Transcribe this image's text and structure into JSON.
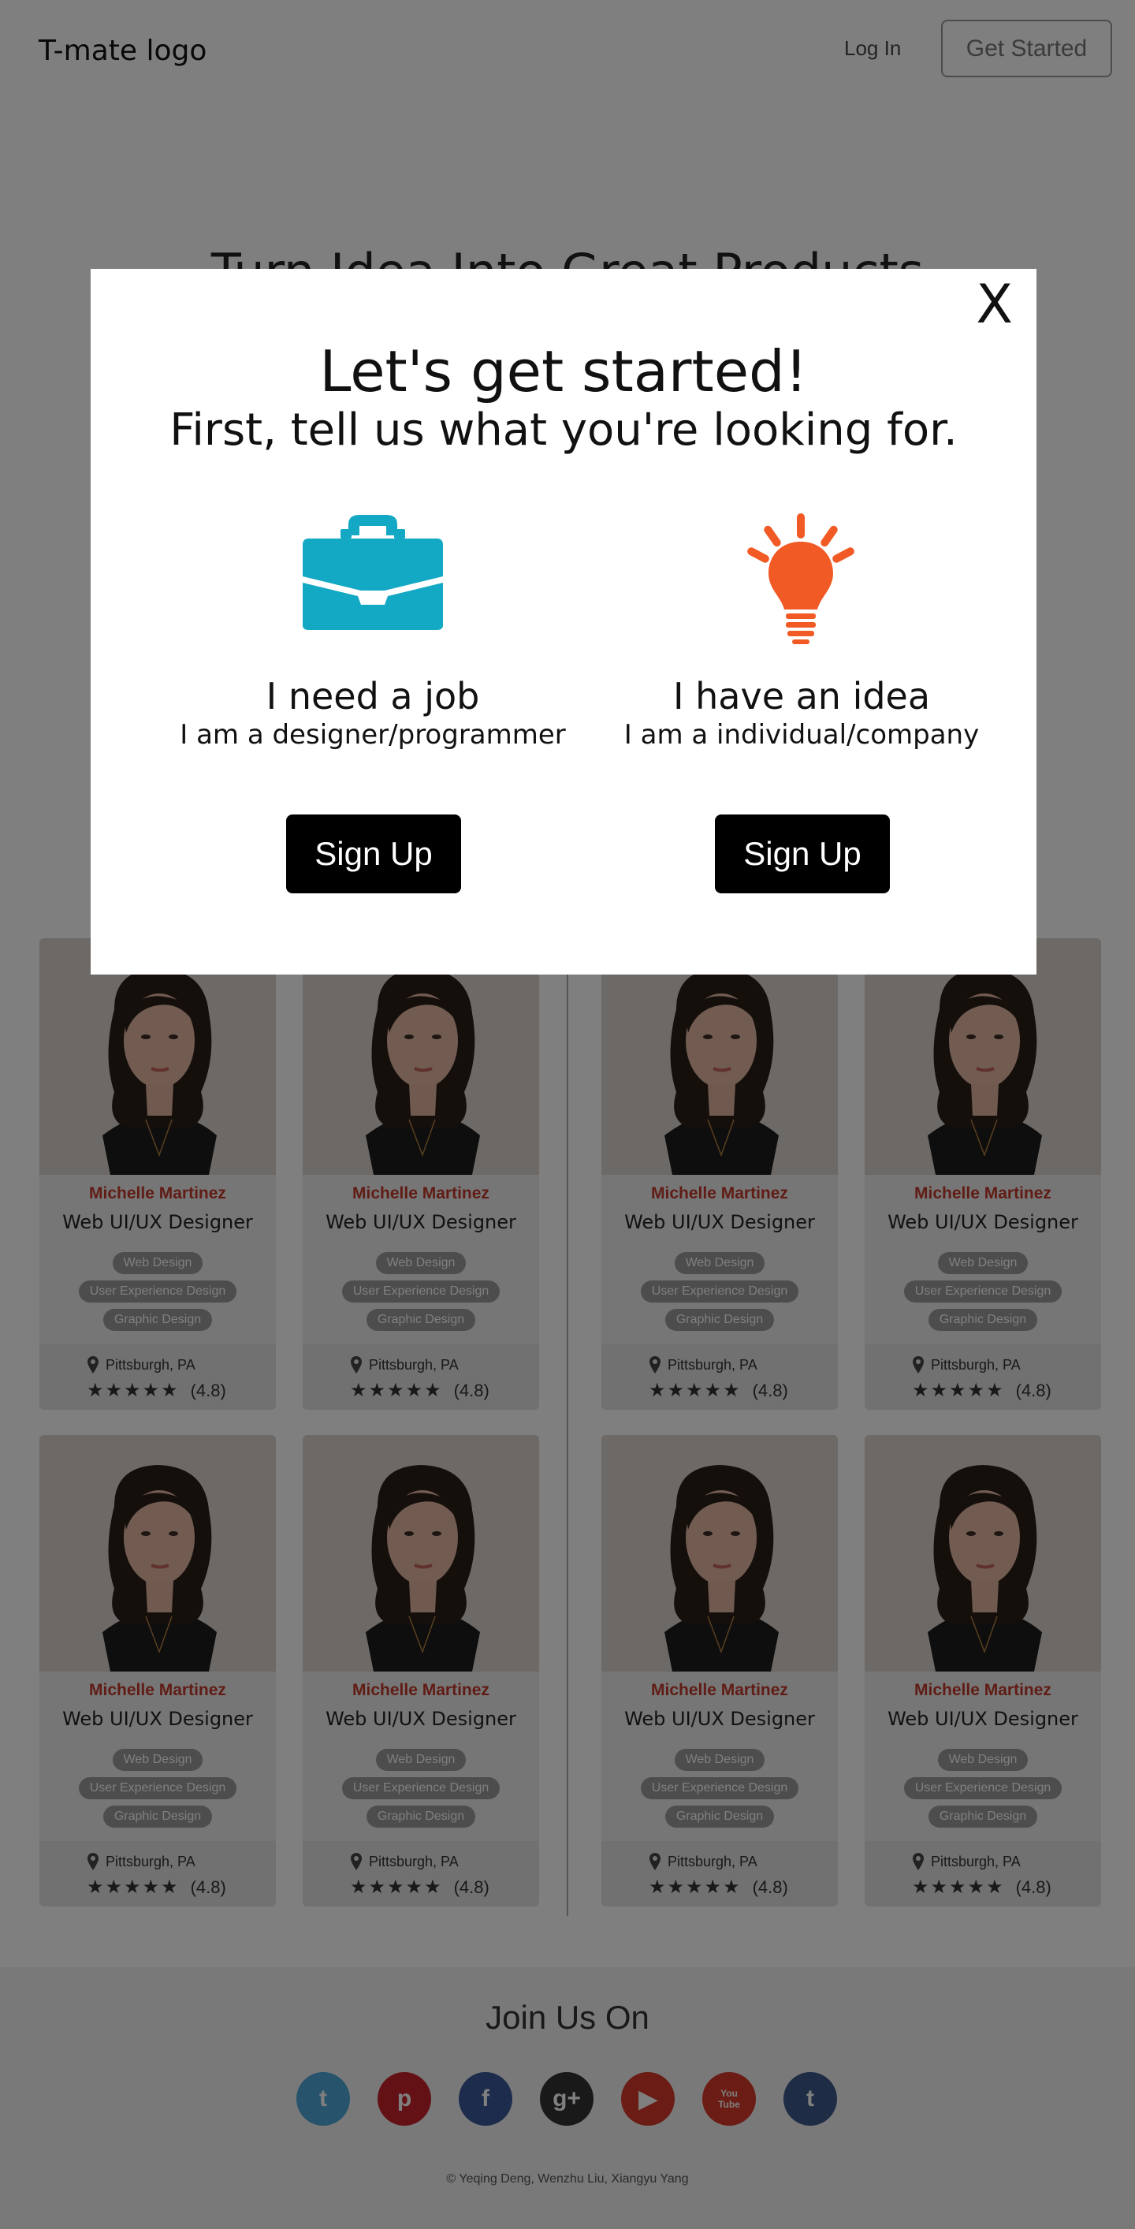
{
  "header": {
    "logo": "T-mate logo",
    "login": "Log In",
    "get_started": "Get Started"
  },
  "hero": {
    "title": "Turn Idea Into Great Products"
  },
  "cards": [
    {
      "name": "Michelle Martinez",
      "role": "Web UI/UX Designer",
      "tags": [
        "Web Design",
        "User Experience Design",
        "Graphic Design"
      ],
      "location": "Pittsburgh, PA",
      "rating": "(4.8)",
      "stars": "★★★★★"
    },
    {
      "name": "Michelle Martinez",
      "role": "Web UI/UX Designer",
      "tags": [
        "Web Design",
        "User Experience Design",
        "Graphic Design"
      ],
      "location": "Pittsburgh, PA",
      "rating": "(4.8)",
      "stars": "★★★★★"
    },
    {
      "name": "Michelle Martinez",
      "role": "Web UI/UX Designer",
      "tags": [
        "Web Design",
        "User Experience Design",
        "Graphic Design"
      ],
      "location": "Pittsburgh, PA",
      "rating": "(4.8)",
      "stars": "★★★★★"
    },
    {
      "name": "Michelle Martinez",
      "role": "Web UI/UX Designer",
      "tags": [
        "Web Design",
        "User Experience Design",
        "Graphic Design"
      ],
      "location": "Pittsburgh, PA",
      "rating": "(4.8)",
      "stars": "★★★★★"
    },
    {
      "name": "Michelle Martinez",
      "role": "Web UI/UX Designer",
      "tags": [
        "Web Design",
        "User Experience Design",
        "Graphic Design"
      ],
      "location": "Pittsburgh, PA",
      "rating": "(4.8)",
      "stars": "★★★★★"
    },
    {
      "name": "Michelle Martinez",
      "role": "Web UI/UX Designer",
      "tags": [
        "Web Design",
        "User Experience Design",
        "Graphic Design"
      ],
      "location": "Pittsburgh, PA",
      "rating": "(4.8)",
      "stars": "★★★★★"
    },
    {
      "name": "Michelle Martinez",
      "role": "Web UI/UX Designer",
      "tags": [
        "Web Design",
        "User Experience Design",
        "Graphic Design"
      ],
      "location": "Pittsburgh, PA",
      "rating": "(4.8)",
      "stars": "★★★★★"
    },
    {
      "name": "Michelle Martinez",
      "role": "Web UI/UX Designer",
      "tags": [
        "Web Design",
        "User Experience Design",
        "Graphic Design"
      ],
      "location": "Pittsburgh, PA",
      "rating": "(4.8)",
      "stars": "★★★★★"
    }
  ],
  "footer": {
    "join": "Join Us On",
    "socials": [
      {
        "icon": "twitter-icon",
        "glyph": "t",
        "color": "#4ea9d8"
      },
      {
        "icon": "pinterest-icon",
        "glyph": "p",
        "color": "#c8232c"
      },
      {
        "icon": "facebook-icon",
        "glyph": "f",
        "color": "#3b5998"
      },
      {
        "icon": "google-plus-icon",
        "glyph": "g+",
        "color": "#333333"
      },
      {
        "icon": "youtube-icon",
        "glyph": "▶",
        "color": "#d63a2a"
      },
      {
        "icon": "youtube-text-icon",
        "glyph": "You Tube",
        "color": "#d63a2a"
      },
      {
        "icon": "tumblr-icon",
        "glyph": "t",
        "color": "#3d5a8a"
      }
    ],
    "copyright": "© Yeqing Deng, Wenzhu Liu, Xiangyu Yang"
  },
  "modal": {
    "close": "X",
    "title": "Let's get started!",
    "subtitle": "First, tell us what you're looking for.",
    "options": [
      {
        "icon": "briefcase-icon",
        "title": "I need a job",
        "desc": "I am a designer/programmer",
        "button": "Sign Up",
        "color": "#13a8c4"
      },
      {
        "icon": "lightbulb-icon",
        "title": "I have an idea",
        "desc": "I am a individual/company",
        "button": "Sign Up",
        "color": "#f15a24"
      }
    ]
  }
}
